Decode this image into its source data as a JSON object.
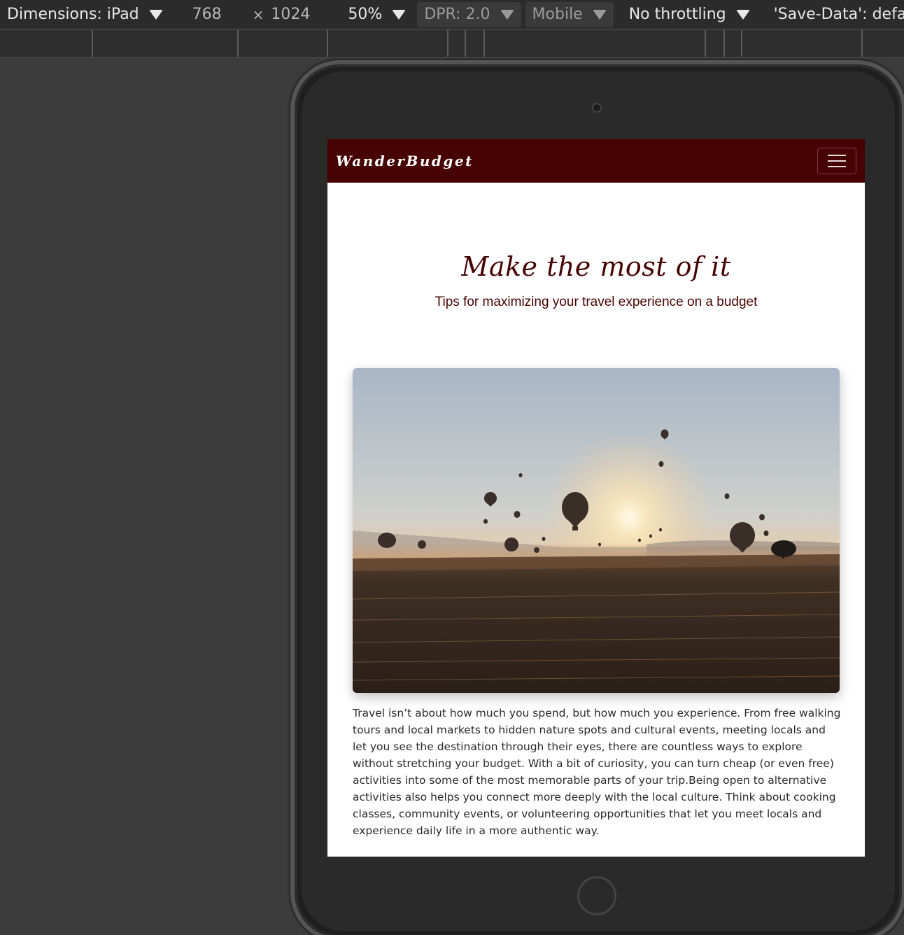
{
  "devtools": {
    "dimensions_label": "Dimensions: iPad",
    "width": "768",
    "times": "×",
    "height": "1024",
    "zoom": "50%",
    "dpr": "DPR: 2.0",
    "device_type": "Mobile",
    "throttling": "No throttling",
    "save_data": "'Save-Data': default"
  },
  "page": {
    "brand": "WanderBudget",
    "hero_title": "Make the most of it",
    "hero_subtitle": "Tips for maximizing your travel experience on a budget",
    "body": "Travel isn’t about how much you spend, but how much you experience. From free walking tours and local markets to hidden nature spots and cultural events, meeting locals and let you see the destination through their eyes, there are countless ways to explore without stretching your budget. With a bit of curiosity, you can turn cheap (or even free) activities into some of the most memorable parts of your trip.Being open to alternative activities also helps you connect more deeply with the local culture. Think about cooking classes, community events, or volunteering opportunities that let you meet locals and experience daily life in a more authentic way."
  },
  "colors": {
    "brand": "#470303",
    "toolbar": "#2b2b2b"
  }
}
